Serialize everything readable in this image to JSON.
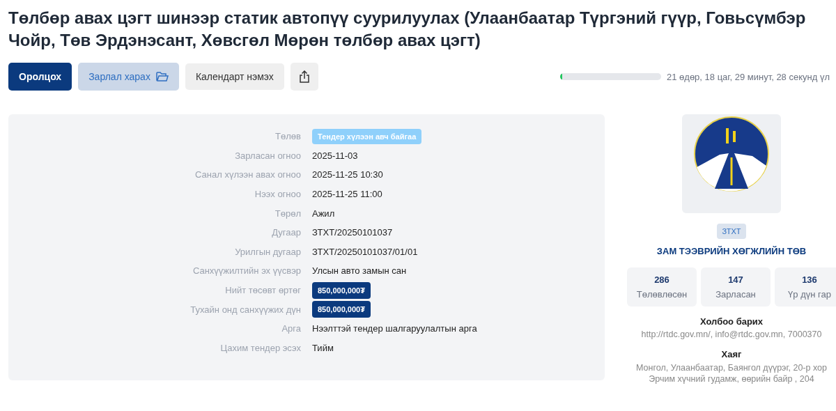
{
  "title": "Төлбөр авах цэгт шинээр статик автопүү суурилуулах (Улаанбаатар Түргэний гүүр, Говьсүмбэр Чойр, Төв Эрдэнэсант, Хөвсгөл Мөрөн төлбөр авах цэгт)",
  "actions": [
    {
      "label": "Оролцох",
      "kind": "primary"
    },
    {
      "label": "Зарлал харах",
      "kind": "folder"
    },
    {
      "label": "Календарт нэмэх",
      "kind": "plain"
    },
    {
      "kind": "share"
    }
  ],
  "countdown": {
    "level": 0.02,
    "text": "21 өдөр, 18 цаг, 29 минут, 28 секунд үл"
  },
  "details": [
    {
      "label": "Төлөв",
      "value": "Тендер хүлээн авч байгаа",
      "kind": "status"
    },
    {
      "label": "Зарласан огноо",
      "value": "2025-11-03",
      "kind": "text"
    },
    {
      "label": "Санал хүлээн авах огноо",
      "value": "2025-11-25 10:30",
      "kind": "text"
    },
    {
      "label": "Нээх огноо",
      "value": "2025-11-25 11:00",
      "kind": "text"
    },
    {
      "label": "Төрөл",
      "value": "Ажил",
      "kind": "text"
    },
    {
      "label": "Дугаар",
      "value": "ЗТХТ/20250101037",
      "kind": "text"
    },
    {
      "label": "Урилгын дугаар",
      "value": "ЗТХТ/20250101037/01/01",
      "kind": "text"
    },
    {
      "label": "Санхүүжилтийн эх үүсвэр",
      "value": "Улсын авто замын сан",
      "kind": "text"
    },
    {
      "label": "Нийт төсөвт өртөг",
      "value": "850,000,000₮",
      "kind": "money"
    },
    {
      "label": "Тухайн онд санхүүжих дүн",
      "value": "850,000,000₮",
      "kind": "money"
    },
    {
      "label": "Арга",
      "value": "Нээлттэй тендер шалгаруулалтын арга",
      "kind": "text"
    },
    {
      "label": "Цахим тендер эсэх",
      "value": "Тийм",
      "kind": "text"
    }
  ],
  "organization": {
    "code": "ЗТХТ",
    "name": "ЗАМ ТЭЭВРИЙН ХӨГЖЛИЙН ТӨВ",
    "stats": [
      {
        "value": "286",
        "label": "Төлөвлөсөн"
      },
      {
        "value": "147",
        "label": "Зарласан"
      },
      {
        "value": "136",
        "label": "Үр дүн гар"
      }
    ],
    "contact": {
      "heading": "Холбоо барих",
      "text": "http://rtdc.gov.mn/, info@rtdc.gov.mn, 7000370"
    },
    "address": {
      "heading": "Хаяг",
      "lines": [
        "Монгол, Улаанбаатар, Баянгол дүүрэг, 20-р хор",
        "Эрчим хүчний гудамж, өөрийн байр , 204"
      ]
    }
  }
}
